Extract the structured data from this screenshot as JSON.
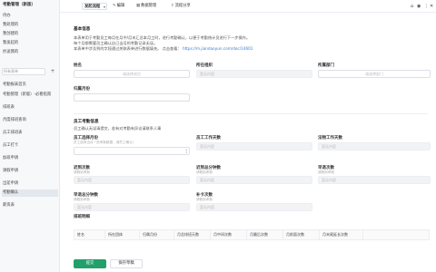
{
  "sidebar": {
    "title": "考勤管理（新版）",
    "search_placeholder": "所有表单",
    "items": [
      {
        "label": "待办"
      },
      {
        "label": "我处理的"
      },
      {
        "label": "我创建的"
      },
      {
        "label": "我发起的"
      },
      {
        "label": "抄送我的"
      },
      {
        "label": "考勤报表首页"
      },
      {
        "label": "考勤管理（新版）-必看指南"
      },
      {
        "label": "排班表"
      },
      {
        "label": "月度排班查询"
      },
      {
        "label": "员工排班表"
      },
      {
        "label": "员工打卡"
      },
      {
        "label": "加班申请"
      },
      {
        "label": "请假申请"
      },
      {
        "label": "出差申请"
      },
      {
        "label": "考勤确认"
      },
      {
        "label": "薪资表"
      }
    ],
    "active_index": 14
  },
  "topbar": {
    "main_button": "发起流程",
    "edit": "编辑",
    "data_manage": "数据管理",
    "publish_share": "流程分享",
    "right_icons": [
      "home-icon",
      "user-icon",
      "more-icon",
      "close-icon"
    ]
  },
  "basic": {
    "title": "基本信息",
    "desc": [
      "本表单用于考勤员工每月在月中/月末汇总本月工时，进行考勤确认，以便于考勤统计员进行下一步操作。",
      "每个月都需要员工确认自己当月的考勤记录无误。",
      "本表单中涉及到的字段通过关联表单进行数据填充。"
    ],
    "link_prefix": "点击查看：",
    "link": "https://m.jiandaoyun.com/doc/14601",
    "name_label": "姓名",
    "name_placeholder": "请选择成员",
    "location_label": "所在组织",
    "location_placeholder": "暂无内容",
    "dept_label": "所属部门",
    "dept_placeholder": "请选择部门",
    "month_label": "归属月份",
    "month_placeholder": ""
  },
  "attendance": {
    "title": "员工考勤信息",
    "note": "员工确认无误请提交，若有对考勤有异议请联系人事",
    "f1_label": "员工选择月份",
    "f1_hint": "员工选择当月一些考勤数据，请员工确认！",
    "f1_placeholder": "",
    "f2_label": "员工工作天数",
    "f2_placeholder": "暂无内容",
    "f3_label": "法物工作天数",
    "f3_placeholder": "暂无内容",
    "f4_label": "迟到次数",
    "f4_hint": "请假到考勤",
    "f4_placeholder": "暂无内容",
    "f5_label": "迟到总分钟数",
    "f5_hint": "请假到考勤",
    "f5_placeholder": "暂无内容",
    "f6_label": "早退次数",
    "f6_hint": "请假到考勤",
    "f6_placeholder": "暂无内容",
    "f7_label": "早退总分钟数",
    "f7_hint": "请假到考勤",
    "f7_placeholder": "暂无内容",
    "f8_label": "补卡次数",
    "f8_hint": "请假到考勤",
    "f8_placeholder": "暂无内容"
  },
  "table": {
    "title": "排班明细",
    "columns": [
      "姓名",
      "所在团体",
      "归属月份",
      "月总排班天数",
      "月中间次数",
      "月最后次数",
      "月前面次数",
      "月末尾延长次数"
    ]
  },
  "footer": {
    "submit": "提交",
    "save_draft": "保存草稿"
  }
}
